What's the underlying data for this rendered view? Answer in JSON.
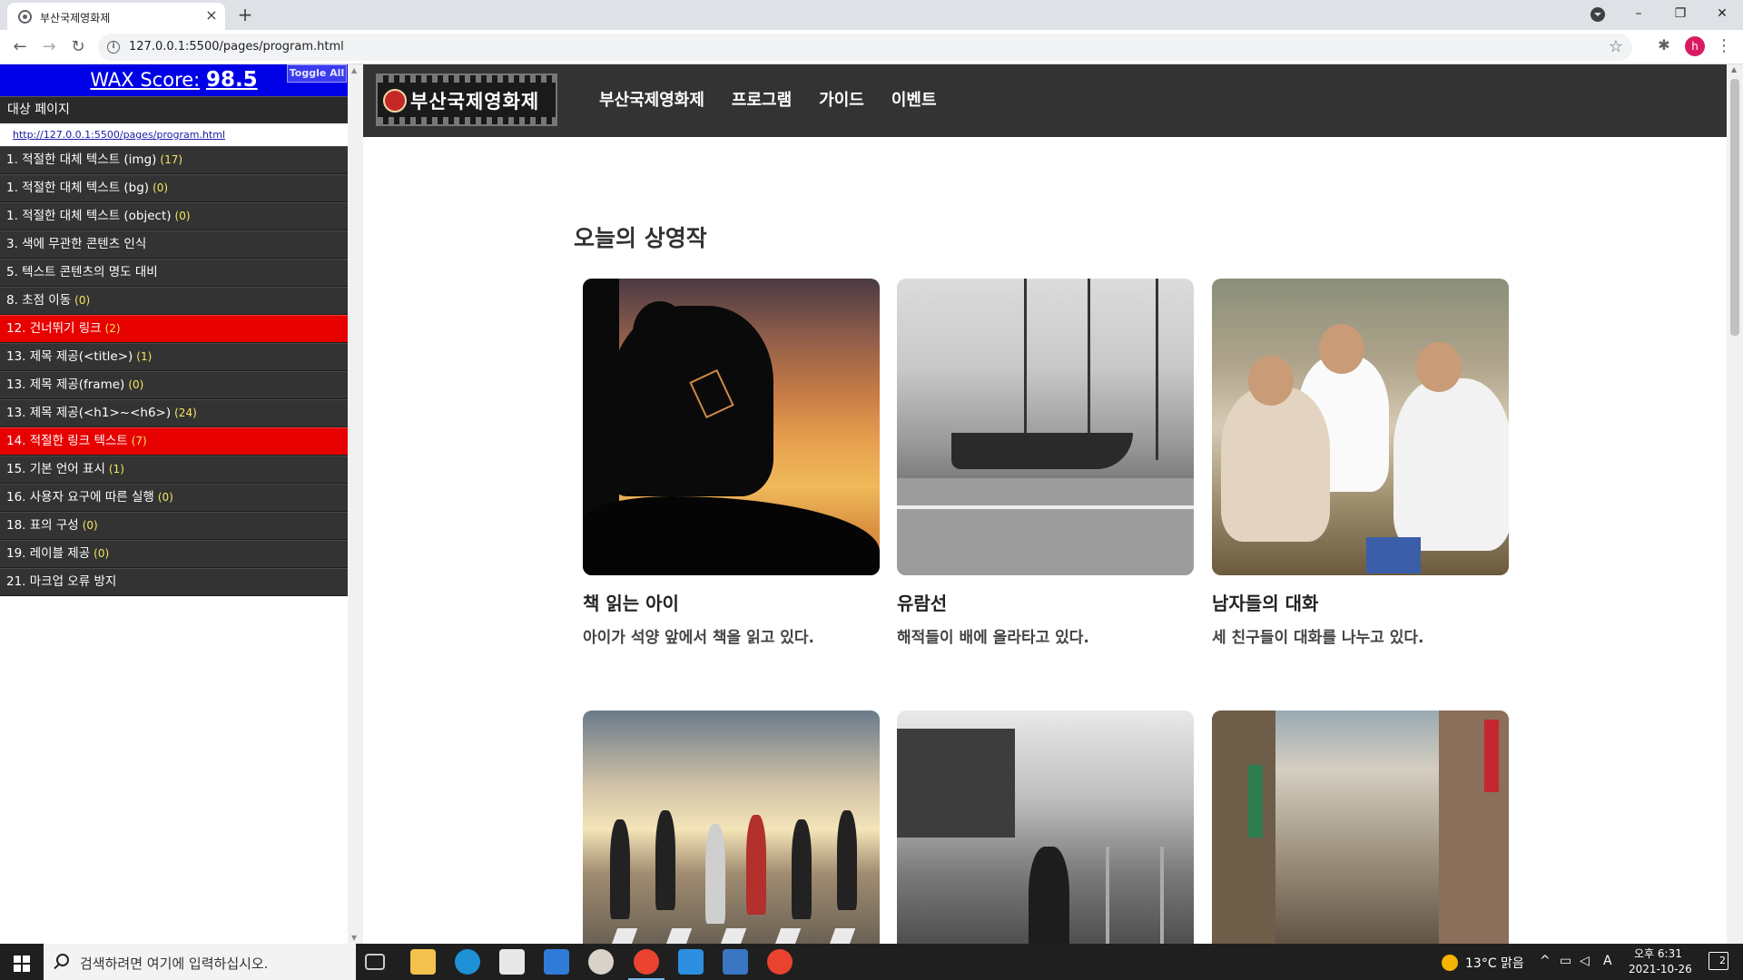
{
  "browser": {
    "tab_title": "부산국제영화제",
    "tab_close": "×",
    "new_tab": "+",
    "url": "127.0.0.1:5500/pages/program.html",
    "window_controls": {
      "minimize": "–",
      "maximize": "❐",
      "close": "✕"
    },
    "profile_initial": "h",
    "icons": [
      "favicon-icon",
      "tab-search-icon",
      "back-icon",
      "forward-icon",
      "reload-icon",
      "info-icon",
      "star-icon",
      "extensions-icon",
      "menu-icon"
    ]
  },
  "wax": {
    "score_label": "WAX Score:",
    "score_value": "98.5",
    "toggle_label": "Toggle All",
    "target_label": "대상 페이지",
    "target_url": "http://127.0.0.1:5500/pages/program.html",
    "items": [
      {
        "label": "1. 적절한 대체 텍스트 (img)",
        "count": "(17)",
        "status": "normal"
      },
      {
        "label": "1. 적절한 대체 텍스트 (bg)",
        "count": "(0)",
        "status": "normal"
      },
      {
        "label": "1. 적절한 대체 텍스트 (object)",
        "count": "(0)",
        "status": "normal"
      },
      {
        "label": "3. 색에 무관한 콘텐츠 인식",
        "count": "",
        "status": "normal"
      },
      {
        "label": "5. 텍스트 콘텐츠의 명도 대비",
        "count": "",
        "status": "normal"
      },
      {
        "label": "8. 초점 이동",
        "count": "(0)",
        "status": "normal"
      },
      {
        "label": "12. 건너뛰기 링크",
        "count": "(2)",
        "status": "error"
      },
      {
        "label": "13. 제목 제공(<title>)",
        "count": "(1)",
        "status": "normal"
      },
      {
        "label": "13. 제목 제공(frame)",
        "count": "(0)",
        "status": "normal"
      },
      {
        "label": "13. 제목 제공(<h1>~<h6>)",
        "count": "(24)",
        "status": "normal"
      },
      {
        "label": "14. 적절한 링크 텍스트",
        "count": "(7)",
        "status": "error"
      },
      {
        "label": "15. 기본 언어 표시",
        "count": "(1)",
        "status": "normal"
      },
      {
        "label": "16. 사용자 요구에 따른 실행",
        "count": "(0)",
        "status": "normal"
      },
      {
        "label": "18. 표의 구성",
        "count": "(0)",
        "status": "normal"
      },
      {
        "label": "19. 레이블 제공",
        "count": "(0)",
        "status": "normal"
      },
      {
        "label": "21. 마크업 오류 방지",
        "count": "",
        "status": "normal"
      }
    ],
    "colors": {
      "score_bg": "#0000e6",
      "error_bg": "#e60000",
      "item_bg": "#333333",
      "count": "#f5e663"
    }
  },
  "site": {
    "logo_text": "부산국제영화제",
    "nav": [
      "부산국제영화제",
      "프로그램",
      "가이드",
      "이벤트"
    ],
    "section_title": "오늘의 상영작",
    "cards": [
      {
        "title": "책 읽는 아이",
        "desc": "아이가 석양 앞에서 책을 읽고 있다.",
        "image": "sunset-reading-photo"
      },
      {
        "title": "유람선",
        "desc": "해적들이 배에 올라타고 있다.",
        "image": "tall-ship-photo"
      },
      {
        "title": "남자들의 대화",
        "desc": "세 친구들이 대화를 나누고 있다.",
        "image": "men-chatting-photo"
      },
      {
        "title": "",
        "desc": "",
        "image": "crosswalk-crowd-photo"
      },
      {
        "title": "",
        "desc": "",
        "image": "railway-musician-photo"
      },
      {
        "title": "",
        "desc": "",
        "image": "city-street-photo"
      }
    ],
    "header_bg": "#333333"
  },
  "taskbar": {
    "search_placeholder": "검색하려면 여기에 입력하십시오.",
    "weather": "13°C 맑음",
    "ime": "A",
    "time": "오후 6:31",
    "date": "2021-10-26",
    "notifications": "2",
    "apps": [
      "task-view-icon",
      "file-explorer-icon",
      "edge-icon",
      "store-icon",
      "mail-icon",
      "paint-icon",
      "chrome-icon",
      "vscode-icon",
      "photos-icon",
      "chrome-icon"
    ]
  }
}
